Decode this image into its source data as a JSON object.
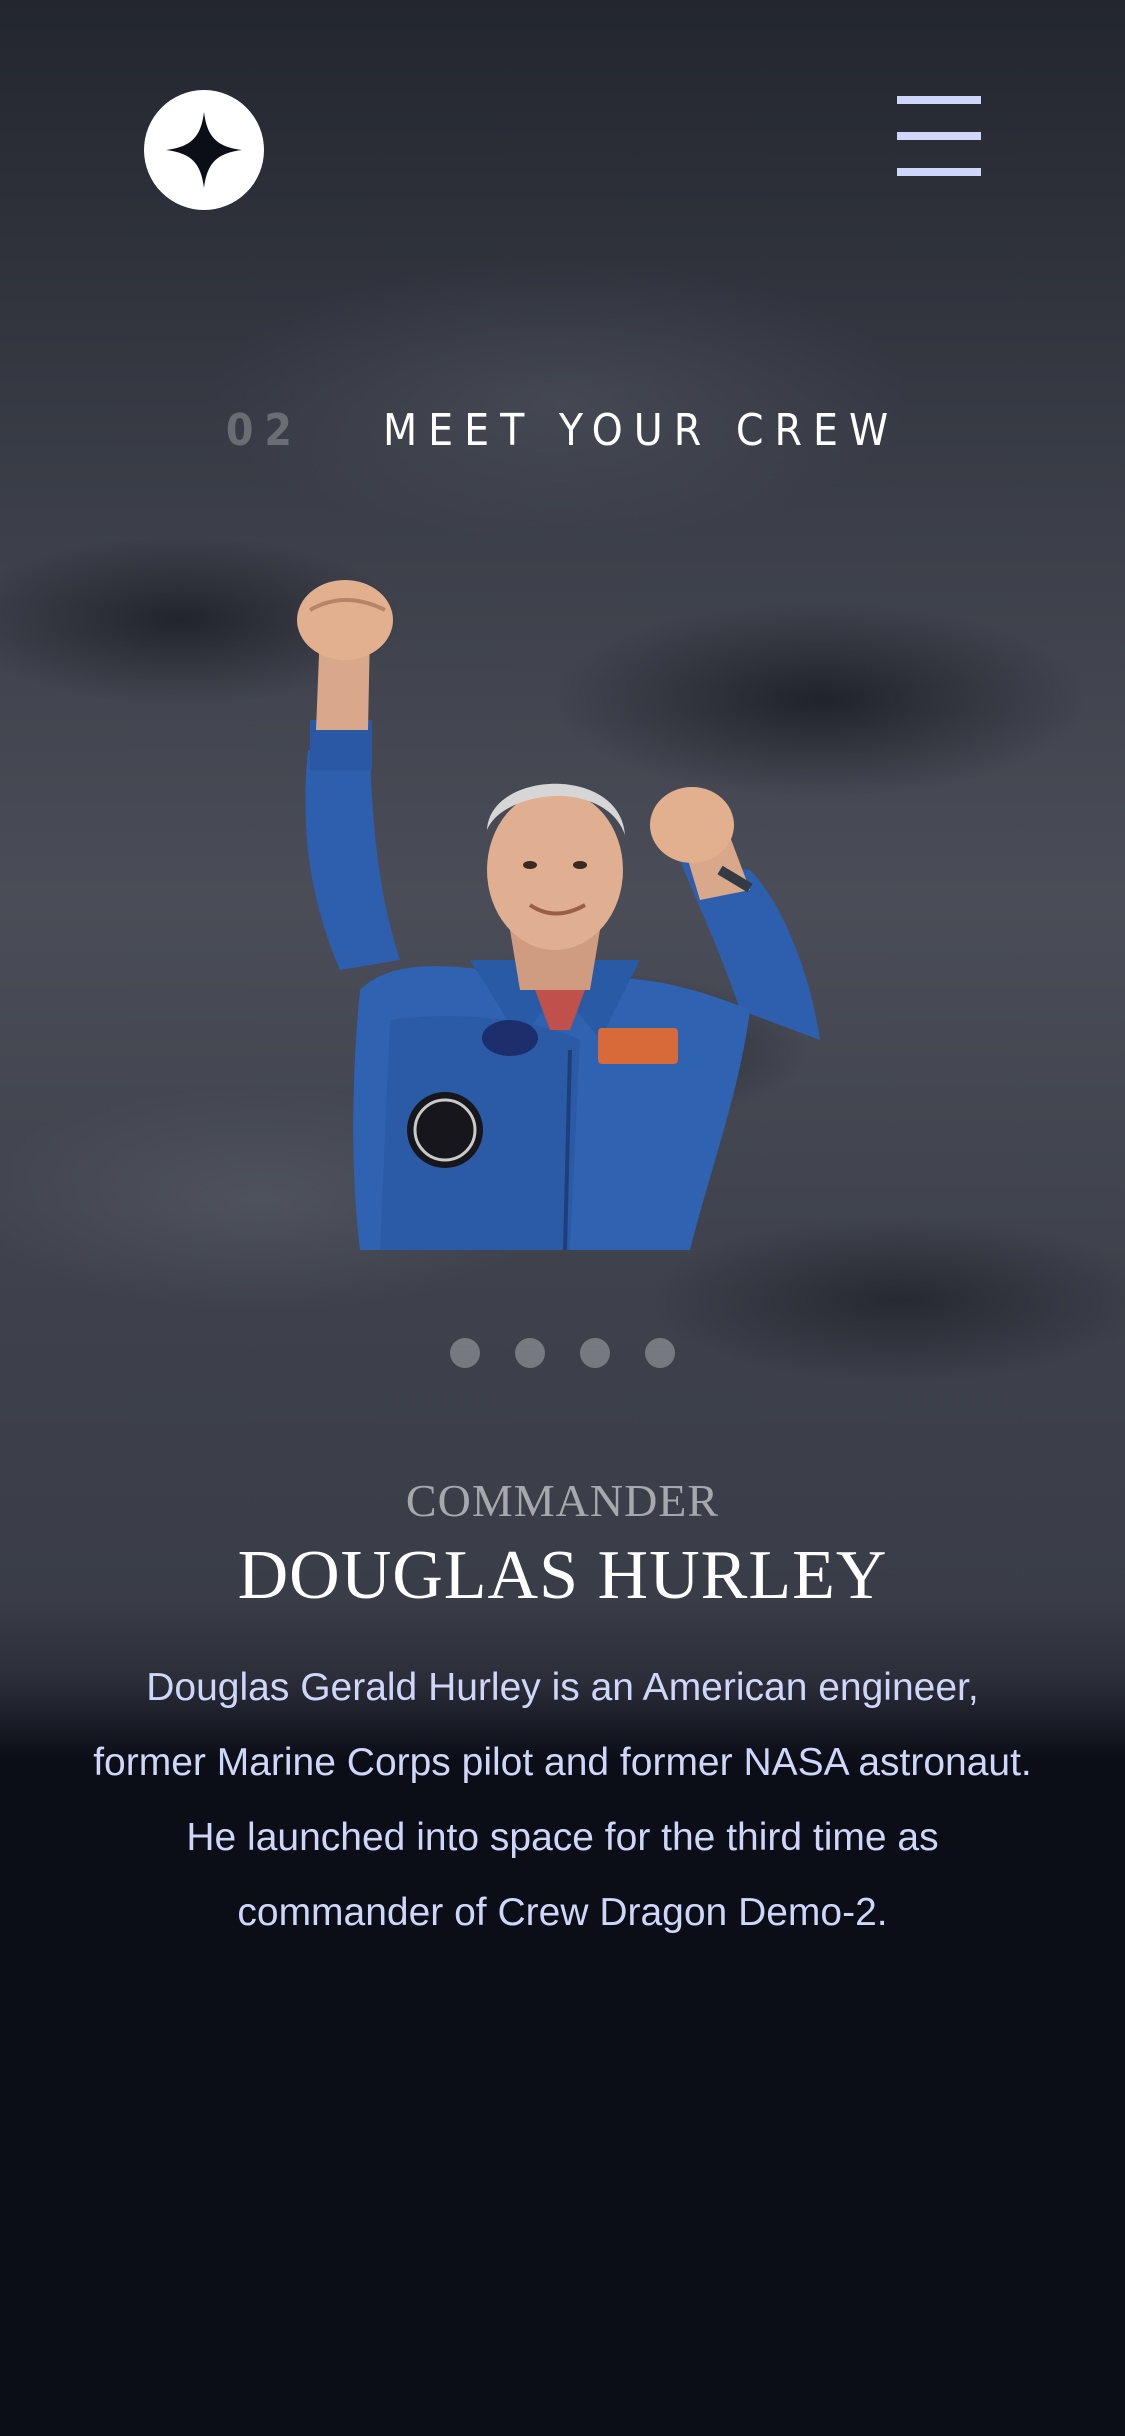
{
  "header": {
    "logo_icon": "star-logo-icon",
    "menu_icon": "hamburger-menu-icon"
  },
  "section": {
    "number": "02",
    "title": "MEET YOUR CREW"
  },
  "crew": {
    "role": "COMMANDER",
    "name": "DOUGLAS HURLEY",
    "bio": "Douglas Gerald Hurley is an American engineer, former Marine Corps pilot and former NASA astronaut. He launched into space for the third time as commander of Crew Dragon Demo-2.",
    "image_subject": "astronaut-in-blue-flight-suit",
    "pagination": {
      "count": 4,
      "active_index": null
    }
  },
  "colors": {
    "background": "#0b0d17",
    "accent": "#d0d6f9",
    "text": "#ffffff"
  }
}
